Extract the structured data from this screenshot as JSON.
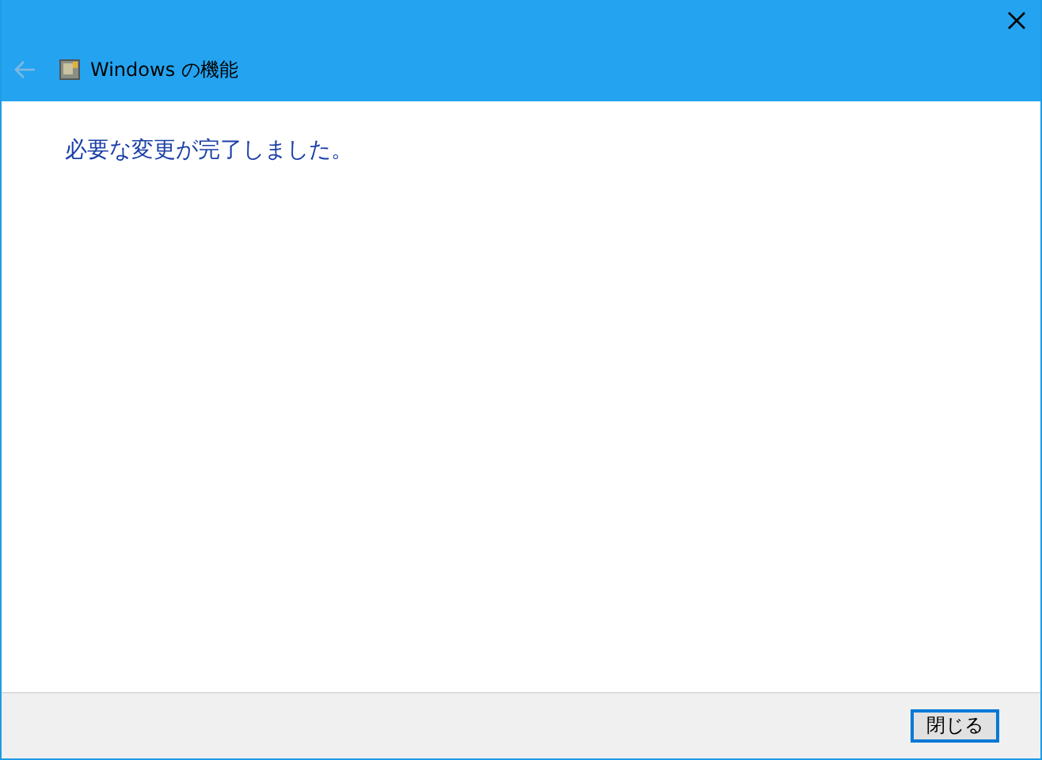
{
  "window": {
    "title": "Windows の機能",
    "back_disabled": true
  },
  "message": "必要な変更が完了しました。",
  "buttons": [
    "閉じる"
  ]
}
